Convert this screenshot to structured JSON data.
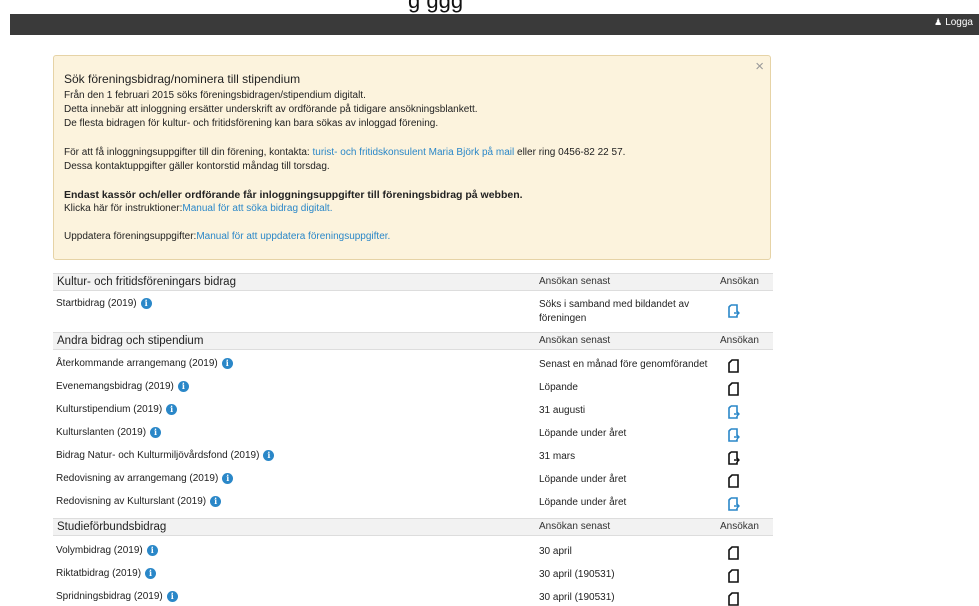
{
  "header": {
    "clipped_title": "g                                   ggg",
    "login_label": "Logga"
  },
  "notice": {
    "title": "Sök föreningsbidrag/nominera till stipendium",
    "line1": "Från den 1 februari 2015 söks föreningsbidragen/stipendium digitalt.",
    "line2": "Detta innebär att inloggning ersätter underskrift av ordförande på tidigare ansökningsblankett.",
    "line3": "De flesta bidragen för kultur- och fritidsförening kan bara sökas av inloggad förening.",
    "contact_prefix": "För att få inloggningsuppgifter till din förening, kontakta: ",
    "contact_link": "turist- och fritidskonsulent Maria Björk på mail",
    "contact_suffix": " eller ring 0456-82 22 57.",
    "contact_hours": "Dessa kontaktuppgifter gäller kontorstid måndag till torsdag.",
    "bold_line": "Endast kassör och/eller ordförande får inloggningsuppgifter till föreningsbidrag på webben.",
    "instr_prefix": "Klicka här för instruktioner:",
    "instr_link": "Manual för att söka bidrag digitalt.",
    "update_prefix": "Uppdatera föreningsuppgifter:",
    "update_link": "Manual för att uppdatera föreningsuppgifter."
  },
  "sections": [
    {
      "title": "Kultur- och fritidsföreningars bidrag",
      "col2": "Ansökan senast",
      "col3": "Ansökan",
      "rows": [
        {
          "name": "Startbidrag (2019)",
          "deadline": "Söks i samband med bildandet av föreningen",
          "icon": "login-doc"
        }
      ]
    },
    {
      "title": "Andra bidrag och stipendium",
      "col2": "Ansökan senast",
      "col3": "Ansökan",
      "rows": [
        {
          "name": "Återkommande arrangemang (2019)",
          "deadline": "Senast en månad före genomförandet",
          "icon": "doc"
        },
        {
          "name": "Evenemangsbidrag (2019)",
          "deadline": "Löpande",
          "icon": "doc"
        },
        {
          "name": "Kulturstipendium (2019)",
          "deadline": "31 augusti",
          "icon": "login-doc"
        },
        {
          "name": "Kulturslanten (2019)",
          "deadline": "Löpande under året",
          "icon": "login-doc"
        },
        {
          "name": "Bidrag Natur- och Kulturmiljövårdsfond (2019)",
          "deadline": "31 mars",
          "icon": "login-doc-dark"
        },
        {
          "name": "Redovisning av arrangemang (2019)",
          "deadline": "Löpande under året",
          "icon": "doc"
        },
        {
          "name": "Redovisning av Kulturslant (2019)",
          "deadline": "Löpande under året",
          "icon": "login-doc"
        }
      ]
    },
    {
      "title": "Studieförbundsbidrag",
      "col2": "Ansökan senast",
      "col3": "Ansökan",
      "rows": [
        {
          "name": "Volymbidrag (2019)",
          "deadline": "30 april",
          "icon": "doc"
        },
        {
          "name": "Riktatbidrag (2019)",
          "deadline": "30 april (190531)",
          "icon": "doc"
        },
        {
          "name": "Spridningsbidrag (2019)",
          "deadline": "30 april (190531)",
          "icon": "doc"
        }
      ]
    }
  ],
  "colors": {
    "accent": "#2a87c8",
    "notice_bg": "#fcf3dd",
    "topbar": "#3a3a3a"
  }
}
